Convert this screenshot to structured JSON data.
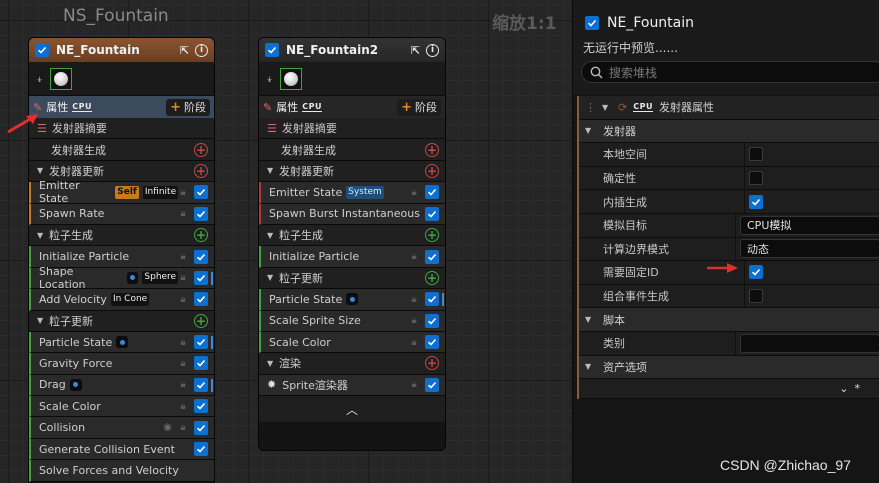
{
  "graph": {
    "title": "NS_Fountain",
    "zoom_label": "缩放1:1"
  },
  "node1": {
    "title": "NE_Fountain",
    "props_label": "属性",
    "cpu_label": "CPU",
    "stage_label": "阶段",
    "summary_label": "发射器摘要",
    "spawn_label": "发射器生成",
    "update_label": "发射器更新",
    "particle_spawn_label": "粒子生成",
    "particle_update_label": "粒子更新",
    "emitter_state": {
      "label": "Emitter State",
      "badge1": "Self",
      "badge2": "Infinite"
    },
    "spawn_rate": "Spawn Rate",
    "init_particle": "Initialize Particle",
    "shape_location": {
      "label": "Shape Location",
      "badge": "Sphere"
    },
    "add_velocity": {
      "label": "Add Velocity",
      "badge": "In Cone"
    },
    "particle_state": "Particle State",
    "gravity_force": "Gravity Force",
    "drag": "Drag",
    "scale_color": "Scale Color",
    "collision": "Collision",
    "gen_collision": "Generate Collision Event",
    "solve_forces": "Solve Forces and Velocity"
  },
  "node2": {
    "title": "NE_Fountain2",
    "props_label": "属性",
    "cpu_label": "CPU",
    "stage_label": "阶段",
    "summary_label": "发射器摘要",
    "spawn_label": "发射器生成",
    "update_label": "发射器更新",
    "emitter_state": {
      "label": "Emitter State",
      "badge": "System"
    },
    "spawn_burst": "Spawn Burst Instantaneous",
    "particle_spawn_label": "粒子生成",
    "init_particle": "Initialize Particle",
    "particle_update_label": "粒子更新",
    "particle_state": "Particle State",
    "scale_sprite_size": "Scale Sprite Size",
    "scale_color": "Scale Color",
    "render_label": "渲染",
    "sprite_renderer": "Sprite渲染器"
  },
  "details": {
    "title": "NE_Fountain",
    "subtitle": "无运行中预览......",
    "search_placeholder": "搜索堆栈",
    "emitter_props": "发射器属性",
    "cpu_label": "CPU",
    "emitter_section": "发射器",
    "local_space": "本地空间",
    "determinism": "确定性",
    "interpolated_spawn": "内插生成",
    "sim_target": "模拟目标",
    "sim_target_value": "CPU模拟",
    "calc_bounds": "计算边界模式",
    "calc_bounds_value": "动态",
    "requires_persistent_id": "需要固定ID",
    "combine_event_spawn": "组合事件生成",
    "script_section": "脚本",
    "category": "类别",
    "asset_options": "资产选项",
    "footer_mark": "*"
  },
  "watermark": "CSDN @Zhichao_97",
  "colors": {
    "accent": "#0d6fd0",
    "header_orange": "#7a4a26",
    "header_dark": "#2b2b2b",
    "arrow": "#e0302a"
  }
}
